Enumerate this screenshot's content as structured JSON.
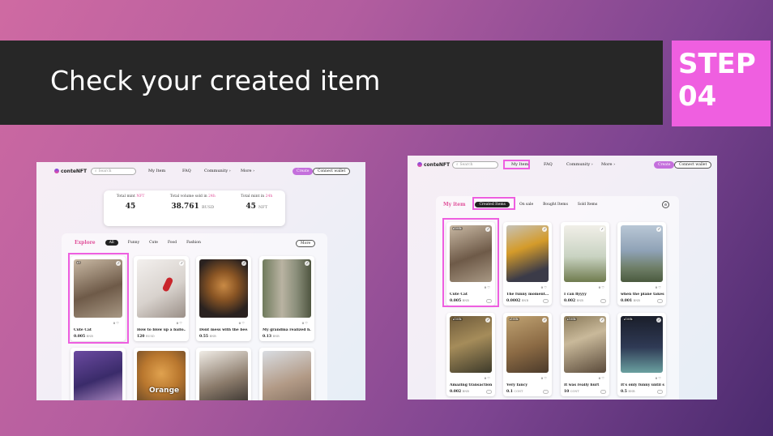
{
  "slide": {
    "title": "Check your created item",
    "step_line1": "STEP",
    "step_line2": "04"
  },
  "colors": {
    "accent_pink": "#ef5fe0",
    "title_bar": "#272727",
    "highlight": "#ee5fe0"
  },
  "left_screenshot": {
    "nav": {
      "logo": "conteNFT",
      "search_placeholder": "Search",
      "links": [
        "My Item",
        "FAQ",
        "Community",
        "More"
      ],
      "create": "Create",
      "connect": "Connect wallet"
    },
    "stats": [
      {
        "label": "Total mint",
        "label_accent": "NFT",
        "value": "45",
        "unit": ""
      },
      {
        "label": "Total volume sold in",
        "label_accent": "24h",
        "value": "38.761",
        "unit": "BUSD"
      },
      {
        "label": "Total mint in",
        "label_accent": "24h",
        "value": "45",
        "unit": "NFT"
      }
    ],
    "explore": {
      "title": "Explore",
      "tabs": [
        "All",
        "Funny",
        "Cute",
        "Food",
        "Fashion"
      ],
      "active_tab": "All",
      "more": "More"
    },
    "cards": [
      {
        "title": "Cute Cat",
        "price": "0.005",
        "unit": "BNB",
        "likes": "0",
        "badge": "▸5",
        "highlighted": true
      },
      {
        "title": "How to blow up a ballo...",
        "price": "120",
        "unit": "BUSD",
        "likes": "0",
        "badge": "",
        "highlighted": false
      },
      {
        "title": "Dont mess with the bee...",
        "price": "0.55",
        "unit": "BNB",
        "likes": "0",
        "badge": "",
        "highlighted": false
      },
      {
        "title": "My grandma realized h...",
        "price": "0.13",
        "unit": "BNB",
        "likes": "0",
        "badge": "",
        "highlighted": false
      }
    ],
    "row2_overlay": "Orange"
  },
  "right_screenshot": {
    "nav": {
      "logo": "conteNFT",
      "search_placeholder": "Search",
      "links": [
        "My Item",
        "FAQ",
        "Community",
        "More"
      ],
      "create": "Create",
      "connect": "Connect wallet"
    },
    "my_item": {
      "title": "My item",
      "tabs": [
        "Created Items",
        "On sale",
        "Bought Items",
        "Sold Items"
      ],
      "active_tab": "Created Items"
    },
    "cards": [
      {
        "title": "Cute Cat",
        "price": "0.005",
        "unit": "BNB",
        "likes": "0",
        "badge": "▸100k",
        "highlighted": true
      },
      {
        "title": "The funny moment...",
        "price": "0.0002",
        "unit": "BNB",
        "likes": "0",
        "badge": "",
        "highlighted": false
      },
      {
        "title": "I can flyyyy",
        "price": "0.002",
        "unit": "BNB",
        "likes": "0",
        "badge": "",
        "highlighted": false
      },
      {
        "title": "when the plane takes off",
        "price": "0.001",
        "unit": "BNB",
        "likes": "0",
        "badge": "",
        "highlighted": false
      },
      {
        "title": "Amazing transaction",
        "price": "0.002",
        "unit": "BNB",
        "likes": "0",
        "badge": "▸100k",
        "highlighted": false
      },
      {
        "title": "Very fancy",
        "price": "0.1",
        "unit": "CONT",
        "likes": "0",
        "badge": "▸100k",
        "highlighted": false
      },
      {
        "title": "It was really hurt",
        "price": "10",
        "unit": "CONT",
        "likes": "0",
        "badge": "▸100k",
        "highlighted": false
      },
      {
        "title": "It's only funny until so...",
        "price": "0.5",
        "unit": "BNB",
        "likes": "0",
        "badge": "▸100k",
        "highlighted": false
      }
    ]
  }
}
